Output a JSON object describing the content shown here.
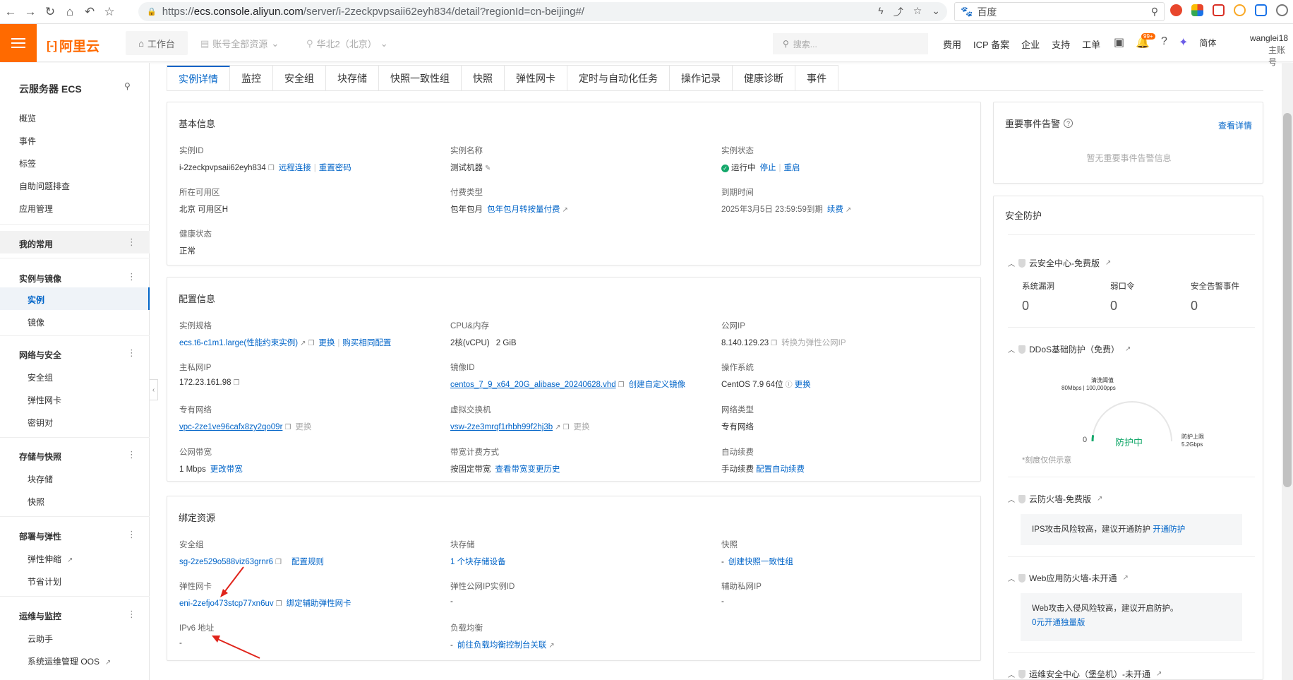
{
  "browser": {
    "url_scheme": "https://",
    "url_host": "ecs.console.aliyun.com",
    "url_path": "/server/i-2zeckpvpsaii62eyh834/detail?regionId=cn-beijing#/",
    "search_engine": "百度"
  },
  "topbar": {
    "brand": "阿里云",
    "workbench": "工作台",
    "resource_group": "账号全部资源",
    "region": "华北2（北京）",
    "search_placeholder": "搜索...",
    "links": [
      "费用",
      "ICP 备案",
      "企业",
      "支持",
      "工单"
    ],
    "notification_badge": "99+",
    "lang": "简体",
    "user_name": "wanglei18",
    "user_sub": "主账号"
  },
  "sidebar": {
    "title": "云服务器 ECS",
    "top_items": [
      "概览",
      "事件",
      "标签",
      "自助问题排查",
      "应用管理"
    ],
    "favorites": "我的常用",
    "groups": [
      {
        "label": "实例与镜像",
        "items": [
          "实例",
          "镜像"
        ]
      },
      {
        "label": "网络与安全",
        "items": [
          "安全组",
          "弹性网卡",
          "密钥对"
        ]
      },
      {
        "label": "存储与快照",
        "items": [
          "块存储",
          "快照"
        ]
      },
      {
        "label": "部署与弹性",
        "items": [
          "弹性伸缩",
          "节省计划"
        ]
      },
      {
        "label": "运维与监控",
        "items": [
          "云助手",
          "系统运维管理 OOS"
        ]
      }
    ]
  },
  "tabs": [
    "实例详情",
    "监控",
    "安全组",
    "块存储",
    "快照一致性组",
    "快照",
    "弹性网卡",
    "定时与自动化任务",
    "操作记录",
    "健康诊断",
    "事件"
  ],
  "basic": {
    "title": "基本信息",
    "instance_id_label": "实例ID",
    "instance_id": "i-2zeckpvpsaii62eyh834",
    "remote_connect": "远程连接",
    "reset_password": "重置密码",
    "name_label": "实例名称",
    "name": "测试机器",
    "status_label": "实例状态",
    "status": "运行中",
    "stop": "停止",
    "restart": "重启",
    "zone_label": "所在可用区",
    "zone": "北京 可用区H",
    "billing_label": "付费类型",
    "billing": "包年包月",
    "billing_switch": "包年包月转按量付费",
    "expire_label": "到期时间",
    "expire": "2025年3月5日 23:59:59到期",
    "renew": "续费",
    "health_label": "健康状态",
    "health": "正常"
  },
  "config": {
    "title": "配置信息",
    "spec_label": "实例规格",
    "spec": "ecs.t6-c1m1.large(性能约束实例)",
    "change": "更换",
    "buy_same": "购买相同配置",
    "cpu_label": "CPU&内存",
    "cpu": "2核(vCPU)",
    "mem": "2 GiB",
    "public_ip_label": "公网IP",
    "public_ip": "8.140.129.23",
    "convert_eip": "转换为弹性公网IP",
    "private_ip_label": "主私网IP",
    "private_ip": "172.23.161.98",
    "image_label": "镜像ID",
    "image": "centos_7_9_x64_20G_alibase_20240628.vhd",
    "create_image": "创建自定义镜像",
    "os_label": "操作系统",
    "os": "CentOS 7.9 64位",
    "os_change": "更换",
    "vpc_label": "专有网络",
    "vpc": "vpc-2ze1ve96cafx8zy2qo09r",
    "vpc_change": "更换",
    "vsw_label": "虚拟交换机",
    "vsw": "vsw-2ze3mrqf1rhbh99f2hj3b",
    "vsw_change": "更换",
    "net_type_label": "网络类型",
    "net_type": "专有网络",
    "bandwidth_label": "公网带宽",
    "bandwidth": "1 Mbps",
    "bandwidth_change": "更改带宽",
    "bw_billing_label": "带宽计费方式",
    "bw_billing": "按固定带宽",
    "bw_history": "查看带宽变更历史",
    "auto_renew_label": "自动续费",
    "auto_renew": "手动续费",
    "auto_renew_config": "配置自动续费"
  },
  "bound": {
    "title": "绑定资源",
    "sg_label": "安全组",
    "sg": "sg-2ze529o588viz63grnr6",
    "sg_rules": "配置规则",
    "disk_label": "块存储",
    "disk": "1 个块存储设备",
    "snap_label": "快照",
    "snap_dash": "-",
    "snap_create": "创建快照一致性组",
    "eni_label": "弹性网卡",
    "eni": "eni-2zefjo473stcp77xn6uv",
    "eni_bind": "绑定辅助弹性网卡",
    "eip_label": "弹性公网IP实例ID",
    "eip": "-",
    "secondary_ip_label": "辅助私网IP",
    "secondary_ip": "-",
    "ipv6_label": "IPv6 地址",
    "ipv6": "-",
    "lb_label": "负载均衡",
    "lb_dash": "-",
    "lb_link": "前往负载均衡控制台关联"
  },
  "events": {
    "title": "重要事件告警",
    "more": "查看详情",
    "empty": "暂无重要事件告警信息"
  },
  "security": {
    "title": "安全防护",
    "center": "云安全中心-免费版",
    "stats": [
      {
        "label": "系统漏洞",
        "value": "0"
      },
      {
        "label": "弱口令",
        "value": "0"
      },
      {
        "label": "安全告警事件",
        "value": "0"
      }
    ],
    "ddos": "DDoS基础防护（免费）",
    "ddos_threshold_title": "清洗阈值",
    "ddos_threshold": "80Mbps | 100,000pps",
    "ddos_zero": "0",
    "ddos_status": "防护中",
    "ddos_limit_title": "防护上限",
    "ddos_limit": "5.2Gbps",
    "ddos_level": 0.05,
    "ddos_note": "*刻度仅供示意",
    "firewall": "云防火墙-免费版",
    "firewall_msg": "IPS攻击风险较高，建议开通防护",
    "firewall_link": "开通防护",
    "waf": "Web应用防火墙-未开通",
    "waf_msg": "Web攻击入侵风险较高，建议开启防护。",
    "waf_link": "0元开通独量版",
    "bastion": "运维安全中心（堡垒机）-未开通"
  },
  "colors": {
    "brand": "#ff6a00",
    "link": "#0064c8",
    "ok": "#15a86b"
  }
}
